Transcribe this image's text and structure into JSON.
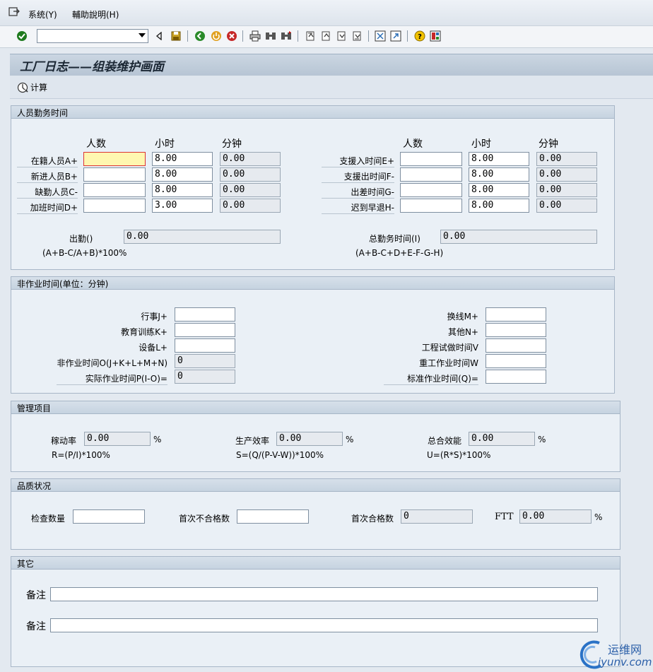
{
  "menu": {
    "system": "系统(Y)",
    "help": "輔助說明(H)"
  },
  "toolbar": {
    "command_value": ""
  },
  "title": "工厂日志——组装维护画面",
  "appbar": {
    "calc_label": "计算"
  },
  "attendance": {
    "header": "人员勤务时间",
    "col_headers": [
      "人数",
      "小时",
      "分钟"
    ],
    "left_rows": [
      {
        "label": "在籍人员A+",
        "count": "",
        "hours": "8.00",
        "minutes": "0.00"
      },
      {
        "label": "新进人员B+",
        "count": "",
        "hours": "8.00",
        "minutes": "0.00"
      },
      {
        "label": "缺勤人员C-",
        "count": "",
        "hours": "8.00",
        "minutes": "0.00"
      },
      {
        "label": "加班时间D+",
        "count": "",
        "hours": "3.00",
        "minutes": "0.00"
      }
    ],
    "right_rows": [
      {
        "label": "支援入时间E+",
        "count": "",
        "hours": "8.00",
        "minutes": "0.00"
      },
      {
        "label": "支援出时间F-",
        "count": "",
        "hours": "8.00",
        "minutes": "0.00"
      },
      {
        "label": "出差时间G-",
        "count": "",
        "hours": "8.00",
        "minutes": "0.00"
      },
      {
        "label": "迟到早退H-",
        "count": "",
        "hours": "8.00",
        "minutes": "0.00"
      }
    ],
    "attendance_label": "出勤()",
    "attendance_value": "0.00",
    "attendance_formula": "(A+B-C/A+B)*100%",
    "total_label": "总勤务时间(I)",
    "total_value": "0.00",
    "total_formula": "(A+B-C+D+E-F-G-H)"
  },
  "nonwork": {
    "header": "非作业时间(单位：分钟)",
    "left_rows": [
      {
        "label": "行事J+",
        "value": ""
      },
      {
        "label": "教育训练K+",
        "value": ""
      },
      {
        "label": "设备L+",
        "value": ""
      },
      {
        "label": "非作业时间O(J+K+L+M+N)",
        "value": "0"
      },
      {
        "label": "实际作业时间P(I-O)=",
        "value": "0"
      }
    ],
    "right_rows": [
      {
        "label": "换线M+",
        "value": ""
      },
      {
        "label": "其他N+",
        "value": ""
      },
      {
        "label": "工程试做时间V",
        "value": ""
      },
      {
        "label": "重工作业时间W",
        "value": ""
      },
      {
        "label": "标准作业时间(Q)=",
        "value": ""
      }
    ]
  },
  "management": {
    "header": "管理项目",
    "items": [
      {
        "label": "稼动率",
        "value": "0.00",
        "unit": "%",
        "formula": "R=(P/I)*100%"
      },
      {
        "label": "生产效率",
        "value": "0.00",
        "unit": "%",
        "formula": "S=(Q/(P-V-W))*100%"
      },
      {
        "label": "总合效能",
        "value": "0.00",
        "unit": "%",
        "formula": "U=(R*S)*100%"
      }
    ]
  },
  "quality": {
    "header": "品质状况",
    "inspect_label": "检查数量",
    "inspect_value": "",
    "first_fail_label": "首次不合格数",
    "first_fail_value": "",
    "first_pass_label": "首次合格数",
    "first_pass_value": "0",
    "ftt_label": "FTT",
    "ftt_value": "0.00",
    "ftt_unit": "%"
  },
  "other": {
    "header": "其它",
    "remark1_label": "备注",
    "remark1_value": "",
    "remark2_label": "备注",
    "remark2_value": ""
  },
  "watermark": {
    "brand": "运维网",
    "site": "iyunv.com"
  },
  "colors": {
    "background": "#e3e9f0",
    "group": "#eaf0f6",
    "header": "#c6d3e0",
    "focus": "#fff7b0"
  }
}
